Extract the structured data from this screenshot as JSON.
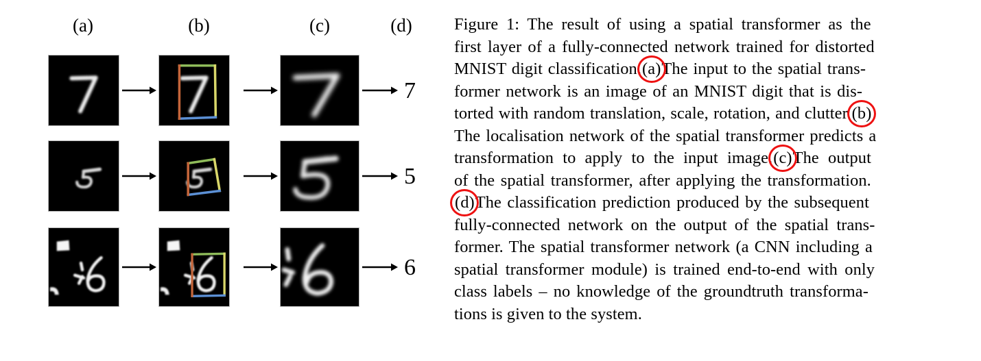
{
  "figure": {
    "column_headers": [
      "(a)",
      "(b)",
      "(c)",
      "(d)"
    ],
    "rows": [
      {
        "input_digit": "7",
        "transformed_digit": "7",
        "output_prediction": "7",
        "bbox_colors": {
          "top": "#8fbc5a",
          "right": "#d9d76a",
          "bottom": "#5b8fd4",
          "left": "#c4653a"
        }
      },
      {
        "input_digit": "5",
        "transformed_digit": "5",
        "output_prediction": "5",
        "bbox_colors": {
          "top": "#8fbc5a",
          "right": "#d9d76a",
          "bottom": "#5b8fd4",
          "left": "#c4653a"
        }
      },
      {
        "input_digit": "6",
        "transformed_digit": "6",
        "output_prediction": "6",
        "bbox_colors": {
          "top": "#8fbc5a",
          "right": "#d9d76a",
          "bottom": "#5b8fd4",
          "left": "#c4653a"
        }
      }
    ],
    "arrow_icon": "arrow-right-icon",
    "panel_background": "#000000"
  },
  "caption": {
    "label": "Figure 1:",
    "full_text": "Figure 1: The result of using a spatial transformer as the first layer of a fully-connected network trained for distorted MNIST digit classification. (a) The input to the spatial transformer network is an image of an MNIST digit that is distorted with random translation, scale, rotation, and clutter. (b) The localisation network of the spatial transformer predicts a transformation to apply to the input image. (c) The output of the spatial transformer, after applying the transformation. (d) The classification prediction produced by the subsequent fully-connected network on the output of the spatial transformer. The spatial transformer network (a CNN including a spatial transformer module) is trained end-to-end with only class labels – no knowledge of the groundtruth transformations is given to the system.",
    "lines": [
      {
        "pre": "Figure 1:  The result of using a spatial transformer as the",
        "mark": null,
        "post": ""
      },
      {
        "pre": "first layer of a fully-connected network trained for distorted",
        "mark": null,
        "post": ""
      },
      {
        "pre": "MNIST digit classification.",
        "mark": "(a)",
        "post": "The input to the spatial trans-"
      },
      {
        "pre": "former network is an image of an MNIST digit that is dis-",
        "mark": null,
        "post": ""
      },
      {
        "pre": "torted with random translation, scale, rotation, and clutter.",
        "mark": "(b)",
        "post": ""
      },
      {
        "pre": "The localisation network of the spatial transformer predicts a",
        "mark": null,
        "post": ""
      },
      {
        "pre": "transformation to apply to the input image.",
        "mark": "(c)",
        "post": "The output"
      },
      {
        "pre": "of the spatial transformer, after applying the transformation.",
        "mark": null,
        "post": ""
      },
      {
        "pre": "",
        "mark": "(d)",
        "post": "The classification prediction produced by the subsequent"
      },
      {
        "pre": "fully-connected network on the output of the spatial trans-",
        "mark": null,
        "post": ""
      },
      {
        "pre": "former. The spatial transformer network (a CNN including a",
        "mark": null,
        "post": ""
      },
      {
        "pre": "spatial transformer module) is trained end-to-end with only",
        "mark": null,
        "post": ""
      },
      {
        "pre": "class labels – no knowledge of the groundtruth transforma-",
        "mark": null,
        "post": ""
      },
      {
        "pre": "tions is given to the system.",
        "mark": null,
        "post": ""
      }
    ],
    "annotation_color": "#ee1111",
    "annotated_refs": [
      "(a)",
      "(b)",
      "(c)",
      "(d)"
    ]
  }
}
